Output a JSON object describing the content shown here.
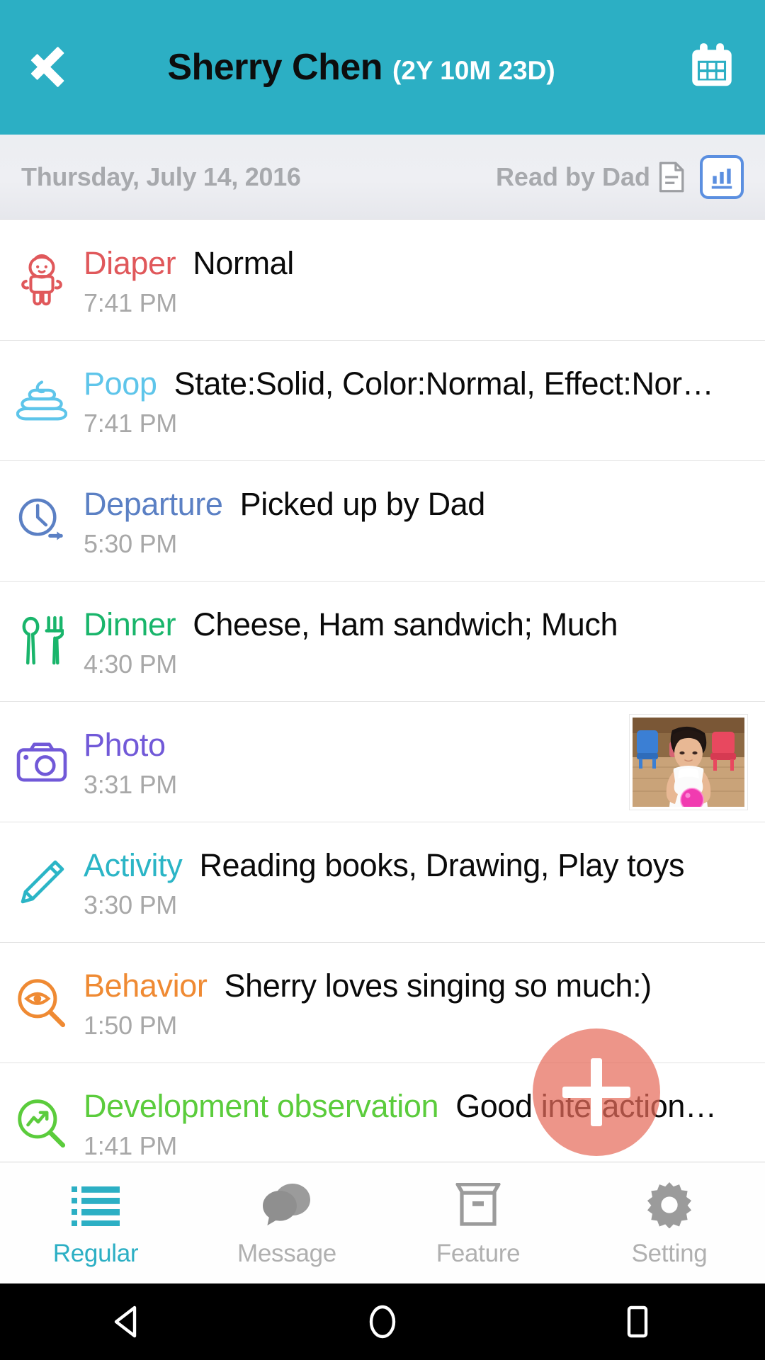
{
  "appbar": {
    "back_icon": "chevron-left-icon",
    "child_name": "Sherry Chen",
    "child_age": "(2Y 10M 23D)",
    "calendar_icon": "calendar-icon",
    "bg_color": "#2cafc4"
  },
  "datebar": {
    "date": "Thursday, July 14, 2016",
    "read_status": "Read by Dad",
    "document_icon": "document-icon",
    "chart_icon": "bar-chart-icon",
    "chart_accent": "#5b8fe0"
  },
  "entries": [
    {
      "icon": "baby-icon",
      "category": "Diaper",
      "category_color": "#e0585b",
      "detail": "Normal",
      "time": "7:41 PM",
      "has_photo": false
    },
    {
      "icon": "poop-icon",
      "category": "Poop",
      "category_color": "#5ec5ea",
      "detail": "State:Solid, Color:Normal, Effect:Nor…",
      "time": "7:41 PM",
      "has_photo": false
    },
    {
      "icon": "clock-departure-icon",
      "category": "Departure",
      "category_color": "#5b80c4",
      "detail": "Picked up by Dad",
      "time": "5:30 PM",
      "has_photo": false
    },
    {
      "icon": "utensils-icon",
      "category": "Dinner",
      "category_color": "#19b56b",
      "detail": "Cheese, Ham sandwich; Much",
      "time": "4:30 PM",
      "has_photo": false
    },
    {
      "icon": "camera-icon",
      "category": "Photo",
      "category_color": "#7159d8",
      "detail": "",
      "time": "3:31 PM",
      "has_photo": true
    },
    {
      "icon": "pencil-icon",
      "category": "Activity",
      "category_color": "#2bb5c6",
      "detail": "Reading books, Drawing, Play toys",
      "time": "3:30 PM",
      "has_photo": false
    },
    {
      "icon": "eye-magnifier-icon",
      "category": "Behavior",
      "category_color": "#ef8a33",
      "detail": "Sherry loves singing so much:)",
      "time": "1:50 PM",
      "has_photo": false
    },
    {
      "icon": "growth-magnifier-icon",
      "category": "Development observation",
      "category_color": "#5bcc3c",
      "detail": "Good interaction…",
      "time": "1:41 PM",
      "has_photo": false
    }
  ],
  "fab": {
    "icon": "plus-icon",
    "color": "#e66c5b"
  },
  "bottomnav": {
    "active_color": "#2cafc4",
    "items": [
      {
        "label": "Regular",
        "icon": "list-icon",
        "active": true
      },
      {
        "label": "Message",
        "icon": "chat-bubbles-icon",
        "active": false
      },
      {
        "label": "Feature",
        "icon": "box-icon",
        "active": false
      },
      {
        "label": "Setting",
        "icon": "gear-icon",
        "active": false
      }
    ]
  },
  "sysbar": {
    "back": "android-back-icon",
    "home": "android-home-icon",
    "recents": "android-recents-icon"
  }
}
